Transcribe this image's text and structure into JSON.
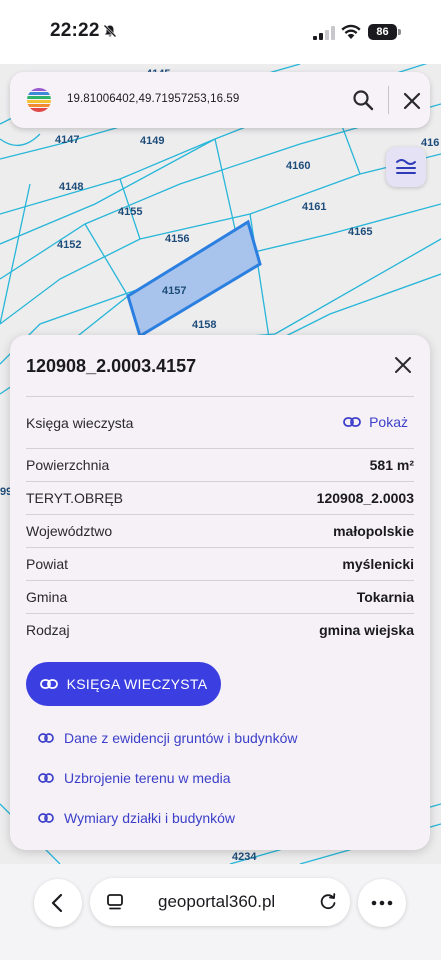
{
  "status_bar": {
    "time": "22:22",
    "battery": "86",
    "icons": [
      "bell-slash-icon",
      "signal-icon",
      "wifi-icon",
      "battery-icon"
    ]
  },
  "search": {
    "value": "19.81006402,49.71957253,16.59",
    "icons": [
      "logo-icon",
      "search-icon",
      "close-icon"
    ]
  },
  "map": {
    "parcels": [
      "4145",
      "4147",
      "4149",
      "4148",
      "4155",
      "4160",
      "4161",
      "4165",
      "4152",
      "4156",
      "4157",
      "4158",
      "4234",
      "416",
      "99"
    ],
    "selected_parcel": "4157",
    "colors": {
      "lines": "#27b6d8",
      "selected_fill": "#a9c4ec",
      "selected_stroke": "#2b7fe0",
      "label": "#1f4d7a"
    }
  },
  "panel": {
    "title": "120908_2.0003.4157",
    "rows": [
      {
        "label": "Księga wieczysta",
        "value": "Pokaż"
      },
      {
        "label": "Powierzchnia",
        "value": "581 m²"
      },
      {
        "label": "TERYT.OBRĘB",
        "value": "120908_2.0003"
      },
      {
        "label": "Województwo",
        "value": "małopolskie"
      },
      {
        "label": "Powiat",
        "value": "myślenicki"
      },
      {
        "label": "Gmina",
        "value": "Tokarnia"
      },
      {
        "label": "Rodzaj",
        "value": "gmina wiejska"
      }
    ],
    "primary_button": "KSIĘGA WIECZYSTA",
    "links": [
      "Dane z ewidencji gruntów i budynków",
      "Uzbrojenie terenu w media",
      "Wymiary działki i budynków"
    ],
    "colors": {
      "accent": "#3b3ee0"
    }
  },
  "browser": {
    "url": "geoportal360.pl",
    "icons": [
      "back-chevron-icon",
      "tabs-icon",
      "reload-icon",
      "more-icon"
    ]
  }
}
